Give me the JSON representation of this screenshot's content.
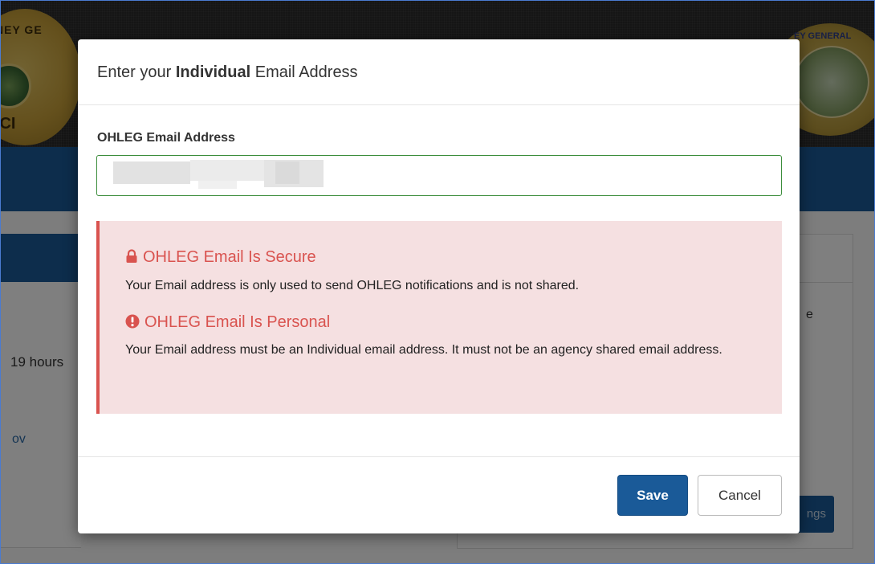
{
  "background": {
    "left_seal_text_top": "ORNEY GE",
    "left_seal_text_bottom": "BCI",
    "right_seal_text": "EY GENERAL",
    "hours_text": "19 hours",
    "gov_text": "ov",
    "partial_text_e": "e",
    "settings_button_partial": "ngs"
  },
  "modal": {
    "title_prefix": "Enter your ",
    "title_bold": "Individual",
    "title_suffix": " Email Address",
    "field_label": "OHLEG Email Address",
    "email_value": "",
    "alert": {
      "secure_heading": "OHLEG Email Is Secure",
      "secure_text": "Your Email address is only used to send OHLEG notifications and is not shared.",
      "personal_heading": "OHLEG Email Is Personal",
      "personal_text": "Your Email address must be an Individual email address. It must not be an agency shared email address."
    },
    "save_label": "Save",
    "cancel_label": "Cancel"
  },
  "colors": {
    "primary": "#1a5a98",
    "danger": "#d9534f",
    "alert_bg": "#f5e0e1",
    "input_border": "#3c8d3c"
  },
  "icons": {
    "secure": "lock-icon",
    "personal": "exclamation-circle-icon"
  }
}
